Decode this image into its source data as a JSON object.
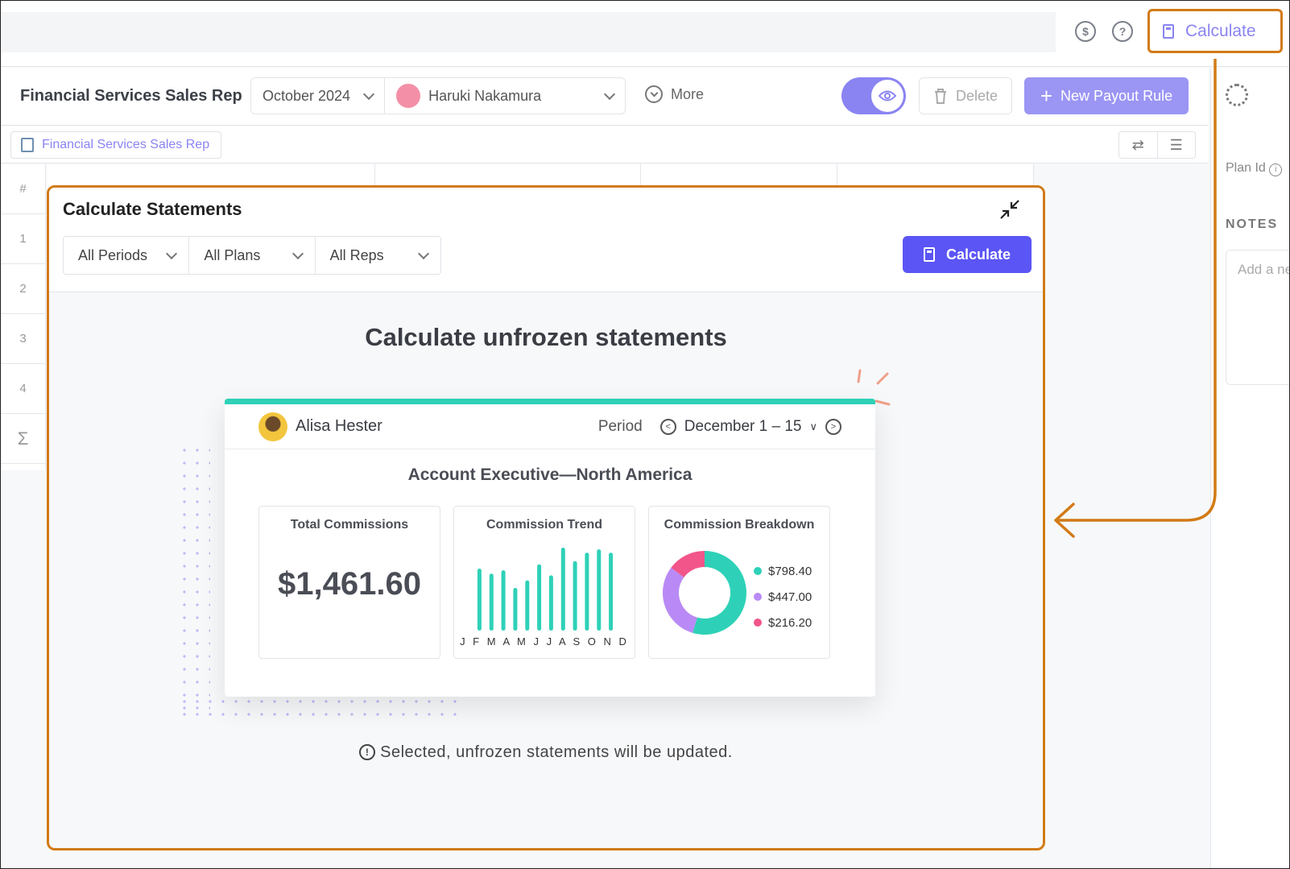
{
  "topbar": {
    "dollar_icon": "dollar-circle-icon",
    "help_icon": "question-circle-icon",
    "calculate_label": "Calculate"
  },
  "toolbar": {
    "plan_title": "Financial Services Sales Rep",
    "period": "October 2024",
    "rep": "Haruki Nakamura",
    "more_label": "More",
    "delete_label": "Delete",
    "new_rule_label": "New Payout Rule"
  },
  "breadcrumb": {
    "label": "Financial Services Sales Rep"
  },
  "grid": {
    "hash": "#",
    "rows": [
      "1",
      "2",
      "3",
      "4"
    ],
    "sum_symbol": "Σ"
  },
  "right_panel": {
    "plan_id_label": "Plan Id",
    "notes_label": "NOTES",
    "notes_placeholder": "Add a ne"
  },
  "modal": {
    "title": "Calculate Statements",
    "filters": [
      "All Periods",
      "All Plans",
      "All Reps"
    ],
    "calculate_label": "Calculate",
    "headline": "Calculate unfrozen statements",
    "note": "Selected, unfrozen statements will be updated."
  },
  "statement_card": {
    "rep_name": "Alisa Hester",
    "period_label": "Period",
    "period_value": "December 1 – 15",
    "plan_name": "Account Executive—North America",
    "total_title": "Total Commissions",
    "total_value": "$1,461.60",
    "trend_title": "Commission Trend",
    "months": "J F M A M J J A S O N D",
    "breakdown_title": "Commission Breakdown"
  },
  "chart_data": [
    {
      "type": "bar",
      "title": "Commission Trend",
      "categories": [
        "J",
        "F",
        "M",
        "A",
        "M",
        "J",
        "J",
        "A",
        "S",
        "O",
        "N",
        "D"
      ],
      "values": [
        74,
        68,
        72,
        51,
        60,
        79,
        66,
        99,
        83,
        93,
        97,
        93
      ],
      "ylim": [
        0,
        100
      ],
      "color": "#2ed1b7"
    },
    {
      "type": "pie",
      "title": "Commission Breakdown",
      "labels": [
        "$798.40",
        "$447.00",
        "$216.20"
      ],
      "values": [
        798.4,
        447.0,
        216.2
      ],
      "colors": [
        "#2ed1b7",
        "#b98af5",
        "#f2558a"
      ]
    }
  ],
  "colors": {
    "accent": "#5b55f5",
    "highlight": "#d27a16",
    "teal": "#2ed1b7"
  }
}
